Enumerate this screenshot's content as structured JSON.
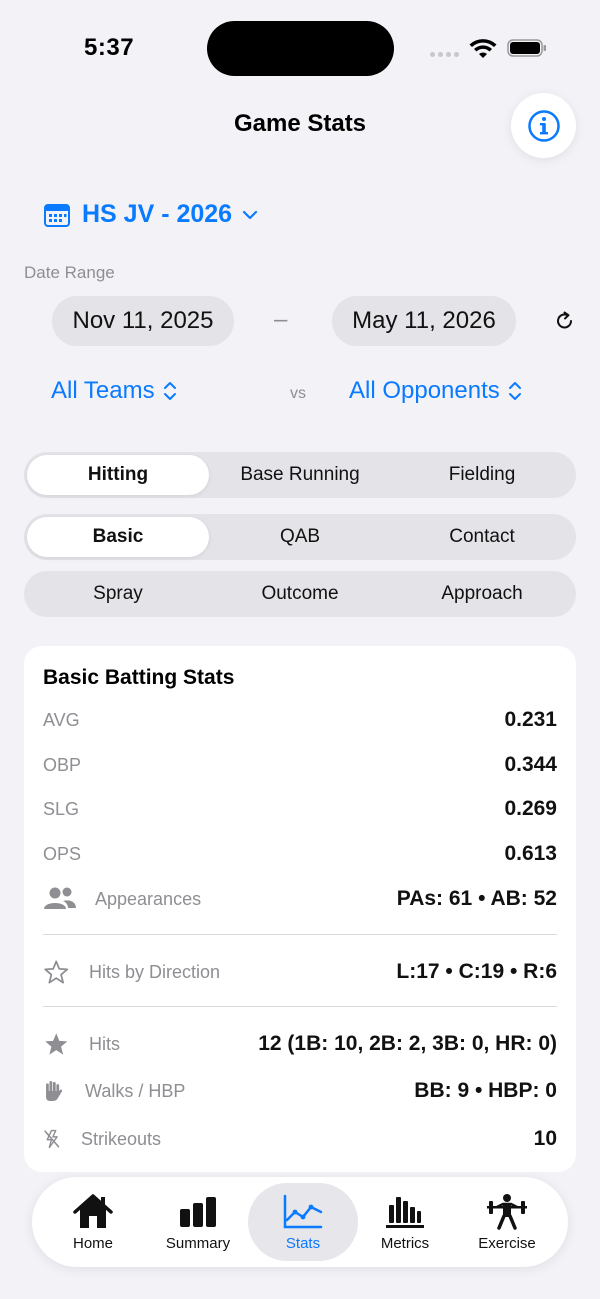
{
  "status_bar": {
    "time": "5:37"
  },
  "header": {
    "title": "Game Stats",
    "info_icon": "info-circle-icon"
  },
  "season": {
    "label": "HS JV - 2026",
    "icon": "calendar-icon"
  },
  "date_range": {
    "label": "Date Range",
    "from": "Nov 11, 2025",
    "separator": "–",
    "to": "May 11, 2026"
  },
  "filters": {
    "teams": "All Teams",
    "vs": "vs",
    "opponents": "All Opponents"
  },
  "segments": {
    "category": [
      "Hitting",
      "Base Running",
      "Fielding"
    ],
    "sub1": [
      "Basic",
      "QAB",
      "Contact"
    ],
    "sub2": [
      "Spray",
      "Outcome",
      "Approach"
    ]
  },
  "card": {
    "title": "Basic Batting Stats",
    "avg": {
      "label": "AVG",
      "value": "0.231"
    },
    "obp": {
      "label": "OBP",
      "value": "0.344"
    },
    "slg": {
      "label": "SLG",
      "value": "0.269"
    },
    "ops": {
      "label": "OPS",
      "value": "0.613"
    },
    "appearances": {
      "label": "Appearances",
      "value": "PAs: 61  •  AB: 52"
    },
    "hits_direction": {
      "label": "Hits by Direction",
      "value": "L:17  •  C:19  •  R:6"
    },
    "hits": {
      "label": "Hits",
      "value": "12  (1B: 10, 2B: 2, 3B: 0, HR: 0)"
    },
    "walks": {
      "label": "Walks / HBP",
      "value": "BB: 9  •  HBP: 0"
    },
    "strikeouts": {
      "label": "Strikeouts",
      "value": "10"
    }
  },
  "tabs": [
    {
      "label": "Home",
      "icon": "house-icon"
    },
    {
      "label": "Summary",
      "icon": "bar-chart-icon"
    },
    {
      "label": "Stats",
      "icon": "line-chart-icon"
    },
    {
      "label": "Metrics",
      "icon": "metrics-icon"
    },
    {
      "label": "Exercise",
      "icon": "weightlifting-icon"
    }
  ],
  "colors": {
    "accent": "#0a7aff",
    "background": "#f2f2f7",
    "secondary_text": "#8e8e93"
  }
}
